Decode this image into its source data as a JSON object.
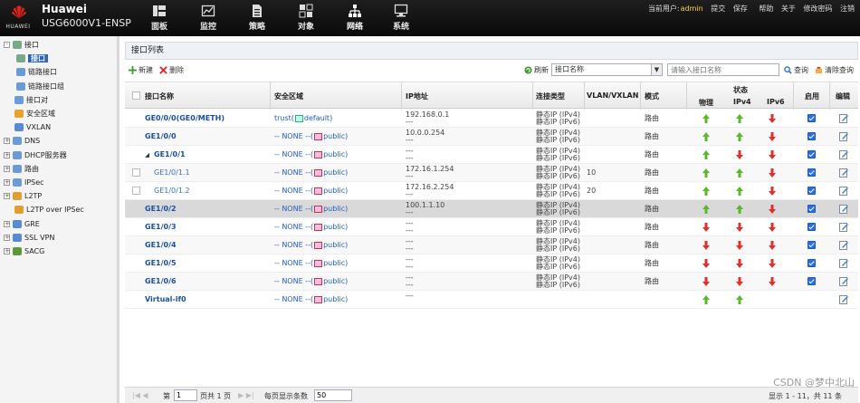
{
  "header": {
    "brand": "Huawei",
    "model": "USG6000V1-ENSP",
    "logo_text": "HUAWEI",
    "nav": [
      {
        "label": "面板",
        "icon": "dashboard-icon"
      },
      {
        "label": "监控",
        "icon": "monitor-icon"
      },
      {
        "label": "策略",
        "icon": "policy-icon"
      },
      {
        "label": "对象",
        "icon": "object-icon"
      },
      {
        "label": "网络",
        "icon": "network-icon",
        "active": true
      },
      {
        "label": "系统",
        "icon": "system-icon"
      }
    ],
    "user_prefix": "当前用户:",
    "user_name": "admin",
    "submit": "提交",
    "save": "保存",
    "help": "帮助",
    "about": "关于",
    "change_password": "修改密码",
    "logout": "注销"
  },
  "sidebar": {
    "items": [
      {
        "label": "接口",
        "icon": "interface-icon",
        "expand": "-"
      },
      {
        "label": "接口",
        "icon": "interface-icon",
        "selected": true
      },
      {
        "label": "链路接口",
        "icon": "link-icon"
      },
      {
        "label": "链路接口组",
        "icon": "link-group-icon"
      },
      {
        "label": "接口对",
        "icon": "interface-pair-icon"
      },
      {
        "label": "安全区域",
        "icon": "security-zone-icon"
      },
      {
        "label": "VXLAN",
        "icon": "vxlan-icon"
      },
      {
        "label": "DNS",
        "icon": "dns-icon",
        "expand": "+"
      },
      {
        "label": "DHCP服务器",
        "icon": "dhcp-icon",
        "expand": "+"
      },
      {
        "label": "路由",
        "icon": "route-icon",
        "expand": "+"
      },
      {
        "label": "IPSec",
        "icon": "ipsec-icon",
        "expand": "+"
      },
      {
        "label": "L2TP",
        "icon": "l2tp-icon",
        "expand": "+"
      },
      {
        "label": "L2TP over IPSec",
        "icon": "l2tp-ipsec-icon"
      },
      {
        "label": "GRE",
        "icon": "gre-icon",
        "expand": "+"
      },
      {
        "label": "SSL VPN",
        "icon": "ssl-vpn-icon",
        "expand": "+"
      },
      {
        "label": "SACG",
        "icon": "sacg-icon",
        "expand": "+"
      }
    ]
  },
  "panel": {
    "title": "接口列表",
    "new_label": "新建",
    "delete_label": "删除",
    "refresh_label": "刷新",
    "filter_select": "接口名称",
    "search_placeholder": "请输入接口名称",
    "query_label": "查询",
    "clear_label": "清除查询"
  },
  "table": {
    "headers": {
      "name": "接口名称",
      "zone": "安全区域",
      "ip": "IP地址",
      "conn": "连接类型",
      "vlan": "VLAN/VXLAN",
      "mode": "模式",
      "status": "状态",
      "physical": "物理",
      "ipv4": "IPv4",
      "ipv6": "IPv6",
      "enable": "启用",
      "edit": "编辑"
    },
    "rows": [
      {
        "name": "GE0/0/0(GE0/METH)",
        "level": 0,
        "zone_prefix": "trust(",
        "zone_name": "default)",
        "zone_type": "trust",
        "ip1": "192.168.0.1",
        "ip2": "---",
        "conn1": "静态IP (IPv4)",
        "conn2": "静态IP (IPv6)",
        "vlan": "",
        "mode": "路由",
        "phy": "up",
        "v4": "up",
        "v6": "down",
        "enabled": true,
        "edit": true
      },
      {
        "name": "GE1/0/0",
        "level": 0,
        "zone_prefix": "-- NONE --(",
        "zone_name": "public)",
        "zone_type": "none",
        "ip1": "10.0.0.254",
        "ip2": "---",
        "conn1": "静态IP (IPv4)",
        "conn2": "静态IP (IPv6)",
        "vlan": "",
        "mode": "路由",
        "phy": "up",
        "v4": "up",
        "v6": "down",
        "enabled": true,
        "edit": true
      },
      {
        "name": "GE1/0/1",
        "level": 0,
        "collapse": true,
        "zone_prefix": "-- NONE --(",
        "zone_name": "public)",
        "zone_type": "none",
        "ip1": "---",
        "ip2": "---",
        "conn1": "静态IP (IPv4)",
        "conn2": "静态IP (IPv6)",
        "vlan": "",
        "mode": "路由",
        "phy": "up",
        "v4": "down",
        "v6": "down",
        "enabled": true,
        "edit": true
      },
      {
        "name": "GE1/0/1.1",
        "level": 1,
        "checkbox": true,
        "zone_prefix": "-- NONE --(",
        "zone_name": "public)",
        "zone_type": "none",
        "ip1": "172.16.1.254",
        "ip2": "---",
        "conn1": "静态IP (IPv4)",
        "conn2": "静态IP (IPv6)",
        "vlan": "10",
        "mode": "路由",
        "phy": "up",
        "v4": "up",
        "v6": "down",
        "enabled": true,
        "edit": true
      },
      {
        "name": "GE1/0/1.2",
        "level": 1,
        "checkbox": true,
        "zone_prefix": "-- NONE --(",
        "zone_name": "public)",
        "zone_type": "none",
        "ip1": "172.16.2.254",
        "ip2": "---",
        "conn1": "静态IP (IPv4)",
        "conn2": "静态IP (IPv6)",
        "vlan": "20",
        "mode": "路由",
        "phy": "up",
        "v4": "up",
        "v6": "down",
        "enabled": true,
        "edit": true
      },
      {
        "name": "GE1/0/2",
        "level": 0,
        "selected": true,
        "zone_prefix": "-- NONE --(",
        "zone_name": "public)",
        "zone_type": "none",
        "ip1": "100.1.1.10",
        "ip2": "---",
        "conn1": "静态IP (IPv4)",
        "conn2": "静态IP (IPv6)",
        "vlan": "",
        "mode": "路由",
        "phy": "up",
        "v4": "up",
        "v6": "down",
        "enabled": true,
        "edit": true
      },
      {
        "name": "GE1/0/3",
        "level": 0,
        "zone_prefix": "-- NONE --(",
        "zone_name": "public)",
        "zone_type": "none",
        "ip1": "---",
        "ip2": "---",
        "conn1": "静态IP (IPv4)",
        "conn2": "静态IP (IPv6)",
        "vlan": "",
        "mode": "路由",
        "phy": "down",
        "v4": "down",
        "v6": "down",
        "enabled": true,
        "edit": true
      },
      {
        "name": "GE1/0/4",
        "level": 0,
        "zone_prefix": "-- NONE --(",
        "zone_name": "public)",
        "zone_type": "none",
        "ip1": "---",
        "ip2": "---",
        "conn1": "静态IP (IPv4)",
        "conn2": "静态IP (IPv6)",
        "vlan": "",
        "mode": "路由",
        "phy": "down",
        "v4": "down",
        "v6": "down",
        "enabled": true,
        "edit": true
      },
      {
        "name": "GE1/0/5",
        "level": 0,
        "zone_prefix": "-- NONE --(",
        "zone_name": "public)",
        "zone_type": "none",
        "ip1": "---",
        "ip2": "---",
        "conn1": "静态IP (IPv4)",
        "conn2": "静态IP (IPv6)",
        "vlan": "",
        "mode": "路由",
        "phy": "down",
        "v4": "down",
        "v6": "down",
        "enabled": true,
        "edit": true
      },
      {
        "name": "GE1/0/6",
        "level": 0,
        "zone_prefix": "-- NONE --(",
        "zone_name": "public)",
        "zone_type": "none",
        "ip1": "---",
        "ip2": "---",
        "conn1": "静态IP (IPv4)",
        "conn2": "静态IP (IPv6)",
        "vlan": "",
        "mode": "路由",
        "phy": "down",
        "v4": "down",
        "v6": "down",
        "enabled": true,
        "edit": true
      },
      {
        "name": "Virtual-if0",
        "level": 0,
        "zone_prefix": "-- NONE --(",
        "zone_name": "public)",
        "zone_type": "none",
        "ip1": "---",
        "ip2": "",
        "conn1": "",
        "conn2": "",
        "vlan": "",
        "mode": "",
        "phy": "up",
        "v4": "up",
        "v6": "",
        "enabled": false,
        "edit": true
      }
    ]
  },
  "pager": {
    "page_label": "第",
    "page_value": "1",
    "total_pages": "页共 1 页",
    "per_page_label": "每页显示条数",
    "per_page_value": "50",
    "summary": "显示 1 - 11，共 11 条"
  },
  "watermark": "CSDN @梦中北山",
  "colors": {
    "up_arrow": "#5bb82e",
    "down_arrow": "#e0302a",
    "link": "#1a4fa8",
    "selected_tree": "#2b63c6"
  }
}
